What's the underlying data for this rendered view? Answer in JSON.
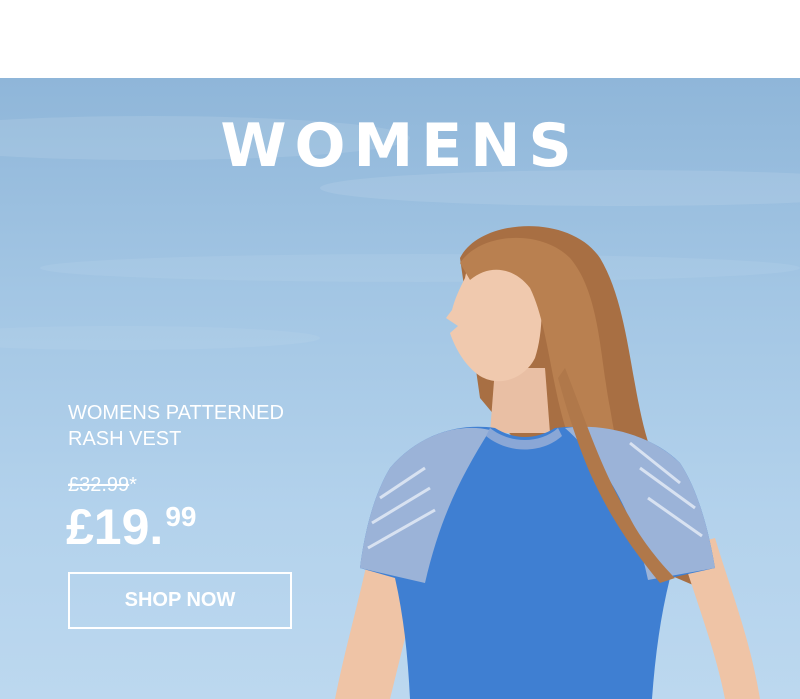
{
  "hero": {
    "title": "WOMENS",
    "product_name_line1": "WOMENS PATTERNED",
    "product_name_line2": "RASH VEST",
    "old_price": "£32.99",
    "old_price_mark": "*",
    "new_price_main": "£19.",
    "new_price_cents": "99",
    "cta_label": "SHOP NOW"
  },
  "colors": {
    "sky_top": "#8fb6d9",
    "sky_bottom": "#bcd8ef",
    "text": "#ffffff",
    "shirt": "#3f7fd2",
    "hair": "#b0784a"
  }
}
